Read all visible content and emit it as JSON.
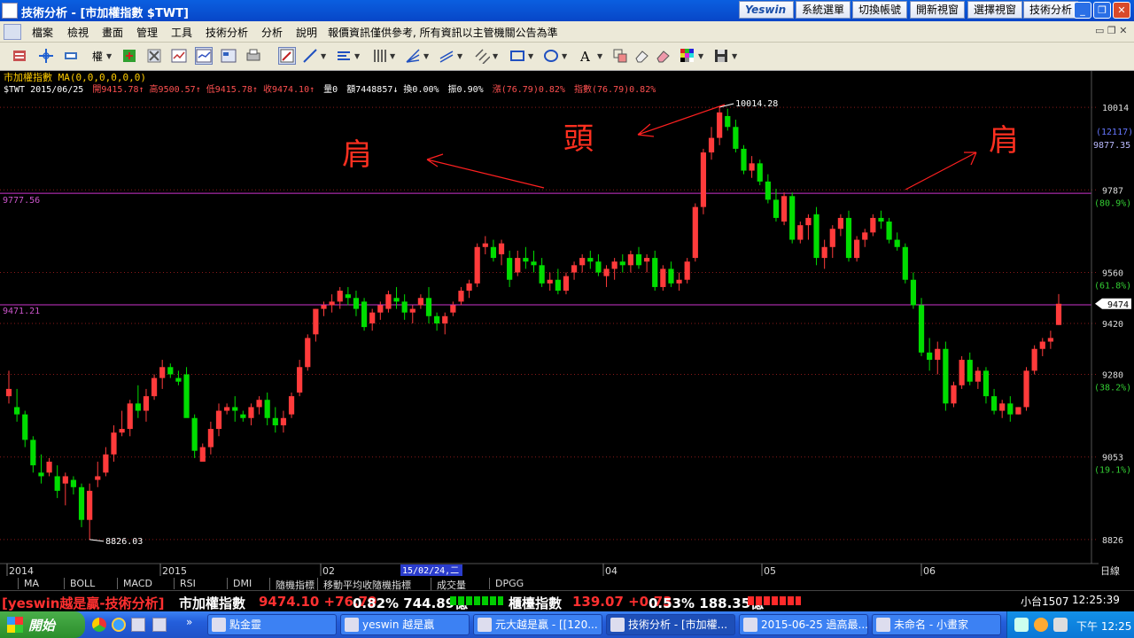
{
  "window": {
    "title": "技術分析 - [市加權指數 $TWT]",
    "buttons": [
      "Yeswin",
      "系統選單",
      "切換帳號",
      "開新視窗",
      "選擇視窗",
      "技術分析"
    ]
  },
  "menu": [
    "檔案",
    "檢視",
    "畫面",
    "管理",
    "工具",
    "技術分析",
    "分析",
    "說明",
    "報價資訊僅供參考, 所有資訊以主管機關公告為準"
  ],
  "toolbar": {
    "weight_label": "權"
  },
  "chart_info": {
    "line1": "市加權指數  MA(0,0,0,0,0,0)",
    "symbol_date": "$TWT 2015/06/25",
    "open": "開9415.78↑",
    "high": "高9500.57↑",
    "low": "低9415.78↑",
    "close": "收9474.10↑",
    "qty": "量0",
    "amount": "額7448857↓",
    "turnover": "換0.00%",
    "amplitude": "振0.90%",
    "change": "漲(76.79)0.82%",
    "index_change": "指數(76.79)0.82%"
  },
  "annotations": {
    "left_shoulder": "肩",
    "head": "頭",
    "right_shoulder": "肩"
  },
  "chart_data": {
    "type": "candlestick",
    "title": "市加權指數 $TWT",
    "xlabel": "",
    "ylabel": "",
    "ylim": [
      8760,
      10080
    ],
    "y_ticks": [
      10014,
      9787,
      9560,
      9420,
      9280,
      9053,
      8826
    ],
    "y_pct_labels": [
      {
        "price": 9787,
        "label": "(80.9%)"
      },
      {
        "price": 9560,
        "label": "(61.8%)"
      },
      {
        "price": 9280,
        "label": "(38.2%)"
      },
      {
        "price": 9053,
        "label": "(19.1%)"
      }
    ],
    "right_labels": {
      "volume": "(12117)",
      "top_price": "9877.35",
      "last_price": "9474"
    },
    "horizontal_lines": [
      {
        "price": 9777.56,
        "label": "9777.56"
      },
      {
        "price": 9471.21,
        "label": "9471.21"
      }
    ],
    "callouts": [
      {
        "label": "10014.28",
        "price": 10014.28
      },
      {
        "label": "8826.03",
        "price": 8826.03
      }
    ],
    "x_labels": [
      "2014",
      "2015",
      "02",
      "04",
      "05",
      "06",
      "日線"
    ],
    "x_cursor_label": "15/02/24,二",
    "colors": {
      "up": "#ff3b3b",
      "down": "#00dd00",
      "level_line": "#cc33cc",
      "info_text": "#ff4040"
    },
    "candles": [
      [
        9220,
        9290,
        9200,
        9240
      ],
      [
        9190,
        9240,
        9150,
        9170
      ],
      [
        9170,
        9180,
        9080,
        9100
      ],
      [
        9100,
        9110,
        9010,
        9030
      ],
      [
        9010,
        9060,
        8980,
        9000
      ],
      [
        9010,
        9050,
        9000,
        9040
      ],
      [
        9000,
        9030,
        8940,
        8960
      ],
      [
        8980,
        9010,
        8920,
        9000
      ],
      [
        8990,
        9000,
        8950,
        8970
      ],
      [
        8970,
        8980,
        8860,
        8880
      ],
      [
        8880,
        8980,
        8826,
        8960
      ],
      [
        8990,
        9040,
        8970,
        9000
      ],
      [
        9010,
        9080,
        9000,
        9060
      ],
      [
        9060,
        9140,
        9040,
        9120
      ],
      [
        9120,
        9180,
        9110,
        9130
      ],
      [
        9130,
        9210,
        9110,
        9200
      ],
      [
        9200,
        9250,
        9160,
        9180
      ],
      [
        9180,
        9240,
        9150,
        9220
      ],
      [
        9220,
        9280,
        9210,
        9270
      ],
      [
        9270,
        9320,
        9240,
        9300
      ],
      [
        9300,
        9310,
        9270,
        9280
      ],
      [
        9270,
        9290,
        9250,
        9260
      ],
      [
        9280,
        9300,
        9240,
        9160
      ],
      [
        9160,
        9170,
        9050,
        9070
      ],
      [
        9040,
        9090,
        9040,
        9080
      ],
      [
        9080,
        9150,
        9060,
        9130
      ],
      [
        9130,
        9200,
        9110,
        9180
      ],
      [
        9180,
        9200,
        9170,
        9190
      ],
      [
        9190,
        9220,
        9150,
        9180
      ],
      [
        9170,
        9180,
        9150,
        9160
      ],
      [
        9160,
        9200,
        9140,
        9190
      ],
      [
        9190,
        9220,
        9170,
        9210
      ],
      [
        9210,
        9230,
        9140,
        9160
      ],
      [
        9160,
        9190,
        9120,
        9140
      ],
      [
        9140,
        9180,
        9120,
        9160
      ],
      [
        9170,
        9230,
        9160,
        9220
      ],
      [
        9230,
        9320,
        9220,
        9300
      ],
      [
        9300,
        9390,
        9290,
        9380
      ],
      [
        9390,
        9460,
        9370,
        9460
      ],
      [
        9460,
        9480,
        9440,
        9470
      ],
      [
        9470,
        9500,
        9450,
        9480
      ],
      [
        9480,
        9520,
        9460,
        9510
      ],
      [
        9500,
        9520,
        9470,
        9490
      ],
      [
        9490,
        9510,
        9440,
        9460
      ],
      [
        9480,
        9490,
        9400,
        9410
      ],
      [
        9420,
        9460,
        9400,
        9450
      ],
      [
        9450,
        9480,
        9430,
        9470
      ],
      [
        9460,
        9510,
        9450,
        9500
      ],
      [
        9490,
        9520,
        9460,
        9480
      ],
      [
        9480,
        9500,
        9430,
        9450
      ],
      [
        9450,
        9470,
        9420,
        9460
      ],
      [
        9470,
        9500,
        9460,
        9490
      ],
      [
        9490,
        9520,
        9420,
        9440
      ],
      [
        9440,
        9450,
        9400,
        9420
      ],
      [
        9420,
        9450,
        9390,
        9440
      ],
      [
        9450,
        9480,
        9440,
        9470
      ],
      [
        9480,
        9520,
        9470,
        9510
      ],
      [
        9510,
        9540,
        9490,
        9530
      ],
      [
        9530,
        9640,
        9520,
        9630
      ],
      [
        9630,
        9660,
        9610,
        9640
      ],
      [
        9630,
        9650,
        9590,
        9600
      ],
      [
        9610,
        9650,
        9580,
        9640
      ],
      [
        9600,
        9620,
        9520,
        9540
      ],
      [
        9560,
        9620,
        9550,
        9600
      ],
      [
        9600,
        9630,
        9570,
        9590
      ],
      [
        9590,
        9620,
        9560,
        9580
      ],
      [
        9580,
        9600,
        9520,
        9530
      ],
      [
        9530,
        9560,
        9510,
        9540
      ],
      [
        9540,
        9570,
        9500,
        9510
      ],
      [
        9510,
        9560,
        9500,
        9550
      ],
      [
        9560,
        9590,
        9540,
        9580
      ],
      [
        9580,
        9610,
        9560,
        9600
      ],
      [
        9600,
        9620,
        9570,
        9590
      ],
      [
        9590,
        9610,
        9550,
        9560
      ],
      [
        9550,
        9580,
        9520,
        9570
      ],
      [
        9570,
        9600,
        9540,
        9590
      ],
      [
        9590,
        9610,
        9560,
        9580
      ],
      [
        9580,
        9620,
        9560,
        9610
      ],
      [
        9610,
        9630,
        9570,
        9580
      ],
      [
        9590,
        9610,
        9560,
        9600
      ],
      [
        9600,
        9620,
        9510,
        9520
      ],
      [
        9520,
        9580,
        9510,
        9570
      ],
      [
        9570,
        9590,
        9520,
        9530
      ],
      [
        9530,
        9560,
        9510,
        9540
      ],
      [
        9540,
        9600,
        9530,
        9590
      ],
      [
        9600,
        9750,
        9590,
        9740
      ],
      [
        9740,
        9900,
        9720,
        9890
      ],
      [
        9890,
        9960,
        9870,
        9930
      ],
      [
        9930,
        10014,
        9910,
        10000
      ],
      [
        9990,
        10010,
        9950,
        9960
      ],
      [
        9960,
        9980,
        9890,
        9900
      ],
      [
        9900,
        9910,
        9830,
        9840
      ],
      [
        9840,
        9880,
        9820,
        9860
      ],
      [
        9860,
        9870,
        9800,
        9810
      ],
      [
        9810,
        9830,
        9750,
        9760
      ],
      [
        9760,
        9790,
        9700,
        9710
      ],
      [
        9700,
        9780,
        9690,
        9770
      ],
      [
        9770,
        9780,
        9640,
        9650
      ],
      [
        9650,
        9700,
        9640,
        9690
      ],
      [
        9690,
        9720,
        9650,
        9710
      ],
      [
        9720,
        9740,
        9580,
        9600
      ],
      [
        9600,
        9650,
        9570,
        9630
      ],
      [
        9630,
        9690,
        9600,
        9680
      ],
      [
        9680,
        9720,
        9660,
        9710
      ],
      [
        9710,
        9730,
        9590,
        9600
      ],
      [
        9600,
        9660,
        9590,
        9650
      ],
      [
        9650,
        9680,
        9630,
        9670
      ],
      [
        9670,
        9720,
        9660,
        9710
      ],
      [
        9710,
        9730,
        9680,
        9700
      ],
      [
        9700,
        9710,
        9640,
        9650
      ],
      [
        9650,
        9670,
        9620,
        9630
      ],
      [
        9630,
        9640,
        9530,
        9540
      ],
      [
        9540,
        9560,
        9460,
        9470
      ],
      [
        9470,
        9490,
        9330,
        9340
      ],
      [
        9340,
        9380,
        9290,
        9320
      ],
      [
        9320,
        9370,
        9280,
        9350
      ],
      [
        9350,
        9370,
        9180,
        9200
      ],
      [
        9200,
        9260,
        9190,
        9250
      ],
      [
        9250,
        9330,
        9240,
        9320
      ],
      [
        9320,
        9340,
        9250,
        9260
      ],
      [
        9260,
        9300,
        9240,
        9290
      ],
      [
        9290,
        9300,
        9200,
        9220
      ],
      [
        9220,
        9240,
        9170,
        9180
      ],
      [
        9180,
        9210,
        9160,
        9200
      ],
      [
        9200,
        9220,
        9150,
        9170
      ],
      [
        9170,
        9190,
        9170,
        9190
      ],
      [
        9190,
        9300,
        9180,
        9290
      ],
      [
        9290,
        9360,
        9280,
        9350
      ],
      [
        9350,
        9380,
        9330,
        9370
      ],
      [
        9370,
        9400,
        9350,
        9380
      ],
      [
        9415.78,
        9500.57,
        9415.78,
        9474.1
      ]
    ]
  },
  "indicator_tabs": [
    "MA",
    "BOLL",
    "MACD",
    "RSI",
    "DMI",
    "隨機指標",
    "移動平均收隨機指標",
    "成交量",
    "DPGG"
  ],
  "ticker": {
    "brand": "[yeswin越是贏-技術分析]",
    "index1_name": "市加權指數",
    "index1_value": "9474.10 +76.79",
    "index1_pct": "0.82% 744.89億",
    "index2_name": "櫃檯指數",
    "index2_value": "139.07 +0.73",
    "index2_pct": "0.53% 188.35億",
    "market": "小台1507",
    "time": "12:25:39"
  },
  "taskbar": {
    "start": "開始",
    "tasks": [
      "點金靈",
      "yeswin 越是贏",
      "元大越是贏 - [[120...",
      "技術分析 - [市加權...",
      "2015-06-25 過高最...",
      "未命名 - 小畫家"
    ],
    "clock": "下午 12:25"
  }
}
